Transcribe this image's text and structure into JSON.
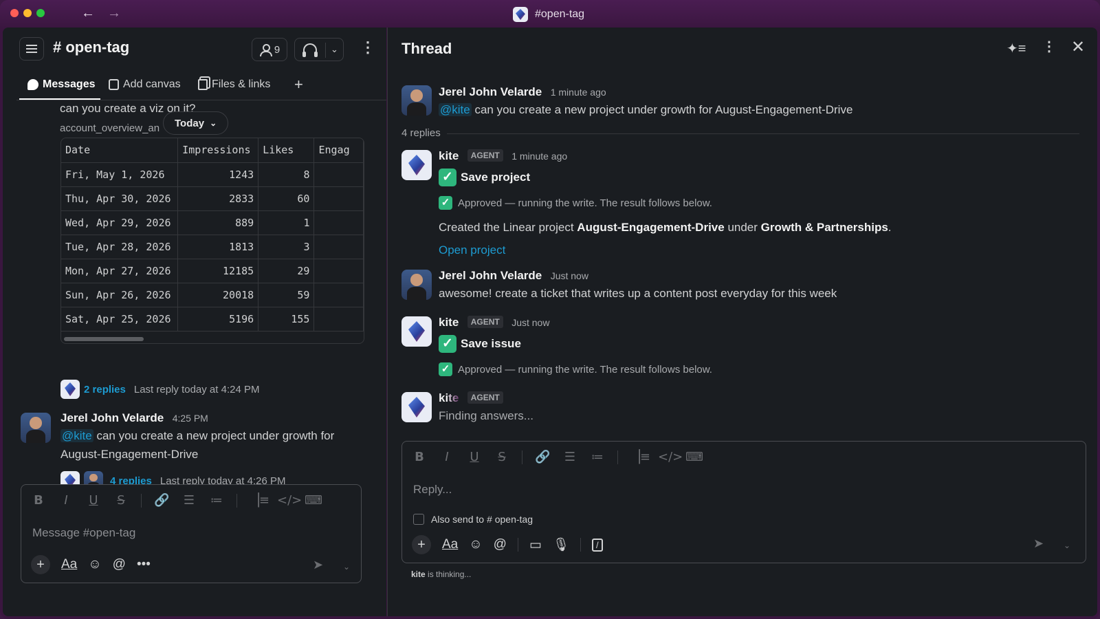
{
  "window": {
    "title": "#open-tag",
    "back_icon": "←",
    "forward_icon": "→"
  },
  "channel": {
    "name": "# open-tag",
    "member_count": "9",
    "tabs": [
      {
        "label": "Messages"
      },
      {
        "label": "Add canvas"
      },
      {
        "label": "Files & links"
      },
      {
        "label": "+"
      }
    ]
  },
  "feed": {
    "cut_text": "can you create a viz on it?",
    "attachment_name": "account_overview_an",
    "date_pill": "Today",
    "table": {
      "headers": [
        "Date",
        "Impressions",
        "Likes",
        "Engag"
      ],
      "rows": [
        [
          "Fri, May 1, 2026",
          "1243",
          "8",
          ""
        ],
        [
          "Thu, Apr 30, 2026",
          "2833",
          "60",
          ""
        ],
        [
          "Wed, Apr 29, 2026",
          "889",
          "1",
          ""
        ],
        [
          "Tue, Apr 28, 2026",
          "1813",
          "3",
          ""
        ],
        [
          "Mon, Apr 27, 2026",
          "12185",
          "29",
          ""
        ],
        [
          "Sun, Apr 26, 2026",
          "20018",
          "59",
          ""
        ],
        [
          "Sat, Apr 25, 2026",
          "5196",
          "155",
          ""
        ]
      ]
    },
    "thread1": {
      "replies": "2 replies",
      "last_reply": "Last reply today at 4:24 PM"
    },
    "message": {
      "author": "Jerel John Velarde",
      "time": "4:25 PM",
      "mention": "@kite",
      "text": " can you create a new project under growth for August-Engagement-Drive"
    },
    "thread2": {
      "replies": "4 replies",
      "last_reply": "Last reply today at 4:26 PM"
    },
    "composer_placeholder": "Message #open-tag"
  },
  "thread": {
    "title": "Thread",
    "root": {
      "author": "Jerel John Velarde",
      "time": "1 minute ago",
      "mention": "@kite",
      "text": " can you create a new project under growth for August-Engagement-Drive"
    },
    "replies_count": "4 replies",
    "reply1": {
      "author": "kite",
      "badge": "AGENT",
      "time": "1 minute ago",
      "action": "Save project",
      "approved": "Approved — running the write. The result follows below.",
      "result_pre": "Created the Linear project ",
      "result_project": "August-Engagement-Drive",
      "result_mid": " under ",
      "result_team": "Growth & Partnerships",
      "result_post": ".",
      "link": "Open project"
    },
    "reply2": {
      "author": "Jerel John Velarde",
      "time": "Just now",
      "text": "awesome! create a ticket that writes up a content post everyday for this week"
    },
    "reply3": {
      "author": "kite",
      "badge": "AGENT",
      "time": "Just now",
      "action": "Save issue",
      "approved": "Approved — running the write. The result follows below."
    },
    "reply4": {
      "author": "kite",
      "badge": "AGENT",
      "text": "Finding answers..."
    },
    "composer_placeholder": "Reply...",
    "also_send_label": "Also send to",
    "also_send_channel": "# open-tag",
    "thinking_name": "kite",
    "thinking_text": " is thinking..."
  },
  "colors": {
    "accent_link": "#1d9bd1",
    "check_green": "#2eb67d",
    "window_bg": "#3a163f",
    "panel_bg": "#1a1d21"
  }
}
